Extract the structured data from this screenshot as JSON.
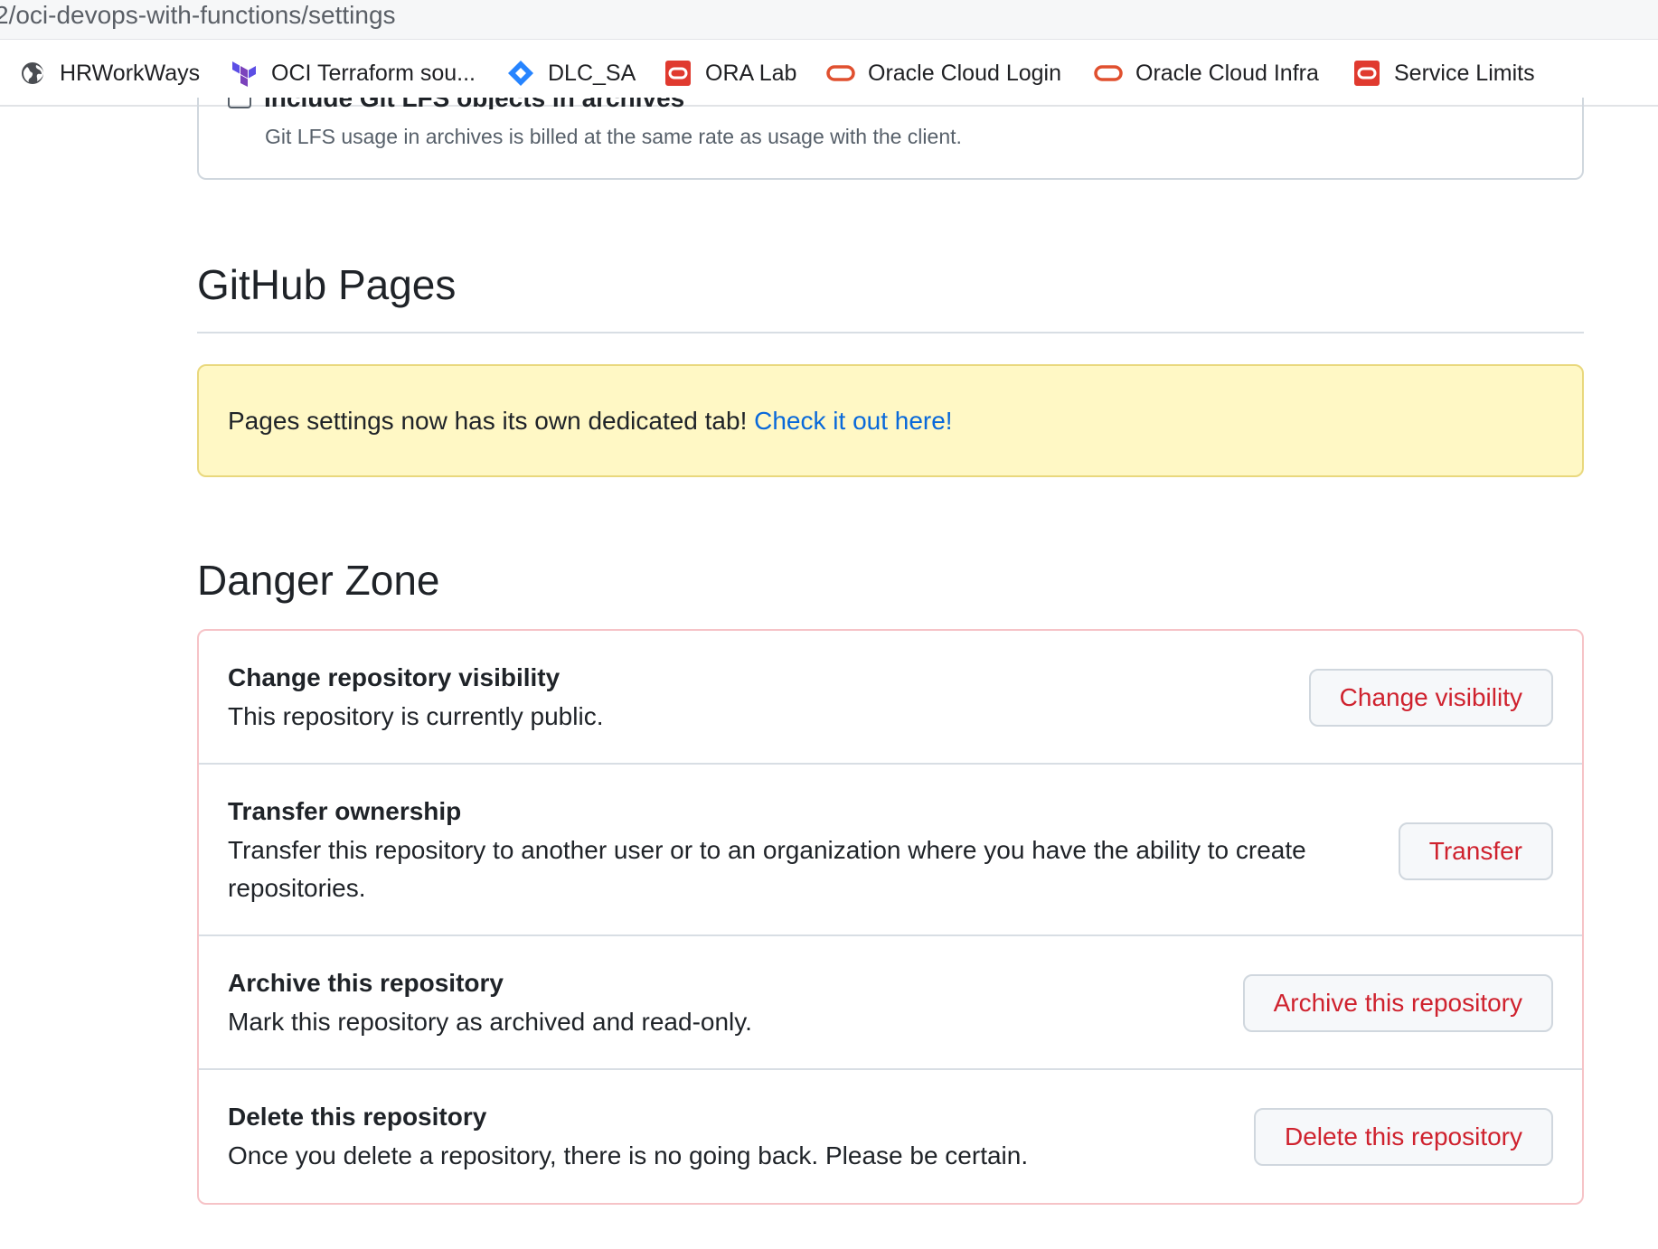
{
  "browser": {
    "url": "2/oci-devops-with-functions/settings",
    "bookmarks": [
      {
        "label": "HRWorkWays",
        "icon": "globe-icon"
      },
      {
        "label": "OCI Terraform sou...",
        "icon": "terraform-icon"
      },
      {
        "label": "DLC_SA",
        "icon": "jira-diamond-icon"
      },
      {
        "label": "ORA Lab",
        "icon": "oracle-red-square-icon"
      },
      {
        "label": "Oracle Cloud Login",
        "icon": "oracle-ring-icon"
      },
      {
        "label": "Oracle Cloud Infra",
        "icon": "oracle-ring-icon"
      },
      {
        "label": "Service Limits",
        "icon": "oracle-red-square-icon"
      }
    ]
  },
  "lfs": {
    "label": "Include Git LFS objects in archives",
    "note": "Git LFS usage in archives is billed at the same rate as usage with the client."
  },
  "pages": {
    "title": "GitHub Pages",
    "notice_text": "Pages settings now has its own dedicated tab! ",
    "notice_link": "Check it out here!"
  },
  "danger": {
    "title": "Danger Zone",
    "items": [
      {
        "title": "Change repository visibility",
        "desc": "This repository is currently public.",
        "button": "Change visibility"
      },
      {
        "title": "Transfer ownership",
        "desc": "Transfer this repository to another user or to an organization where you have the ability to create repositories.",
        "button": "Transfer"
      },
      {
        "title": "Archive this repository",
        "desc": "Mark this repository as archived and read-only.",
        "button": "Archive this repository"
      },
      {
        "title": "Delete this repository",
        "desc": "Once you delete a repository, there is no going back. Please be certain.",
        "button": "Delete this repository"
      }
    ]
  },
  "colors": {
    "danger_text": "#cf222e",
    "link": "#0969da",
    "notice_bg": "#fff8c5",
    "danger_border": "#f6c3c7"
  }
}
